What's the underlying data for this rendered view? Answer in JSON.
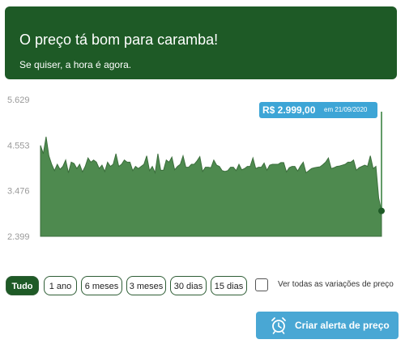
{
  "banner": {
    "title": "O preço tá bom para caramba!",
    "subtitle": "Se quiser, a hora é agora."
  },
  "colors": {
    "brand_green": "#1e5a26",
    "chart_fill": "#4e8a4f",
    "accent_blue": "#49a7d4"
  },
  "chart_data": {
    "type": "area",
    "title": "",
    "xlabel": "",
    "ylabel": "",
    "ylim": [
      2399,
      5629
    ],
    "yticks": [
      "5.629",
      "4.553",
      "3.476",
      "2.399"
    ],
    "grid": false,
    "series": [
      {
        "values": [
          4545,
          4350,
          4750,
          4300,
          4100,
          3950,
          4100,
          3980,
          4050,
          4200,
          3900,
          4150,
          4120,
          4000,
          4100,
          3920,
          4050,
          4250,
          4150,
          4200,
          4150,
          4000,
          4080,
          3930,
          4150,
          4050,
          4100,
          4350,
          4050,
          4100,
          4200,
          4150,
          4150,
          3950,
          4050,
          4000,
          4050,
          4100,
          4300,
          3950,
          4050,
          3900,
          4350,
          3960,
          3960,
          4200,
          4150,
          4270,
          3970,
          4050,
          4100,
          4300,
          4030,
          4030,
          4100,
          4100,
          4180,
          4280,
          3930,
          4030,
          4030,
          4020,
          4200,
          4080,
          4050,
          3950,
          3930,
          3950,
          4030,
          4030,
          3950,
          4100,
          3970,
          4000,
          4050,
          4050,
          4250,
          4000,
          4030,
          4030,
          4130,
          3960,
          4080,
          4100,
          4100,
          4100,
          4140,
          4140,
          3920,
          4020,
          4050,
          4050,
          3940,
          4060,
          4150,
          3900,
          3950,
          4000,
          4020,
          4030,
          4040,
          4090,
          4150,
          4250,
          4000,
          4020,
          4050,
          4060,
          4080,
          4100,
          4150,
          4150,
          4200,
          3960,
          4020,
          4050,
          4080,
          4050,
          4300,
          4000,
          4050,
          3300,
          2999
        ]
      }
    ],
    "highlight": {
      "price": "R$ 2.999,00",
      "date_label": "em 21/09/2020",
      "value": 2999
    }
  },
  "ranges": {
    "items": [
      "Tudo",
      "1 ano",
      "6 meses",
      "3 meses",
      "30 dias",
      "15 dias"
    ],
    "active": "Tudo"
  },
  "variations_checkbox": {
    "label": "Ver todas as variações de preço",
    "checked": false
  },
  "alert_button": {
    "label": "Criar alerta de preço",
    "icon": "alarm-clock-icon"
  }
}
